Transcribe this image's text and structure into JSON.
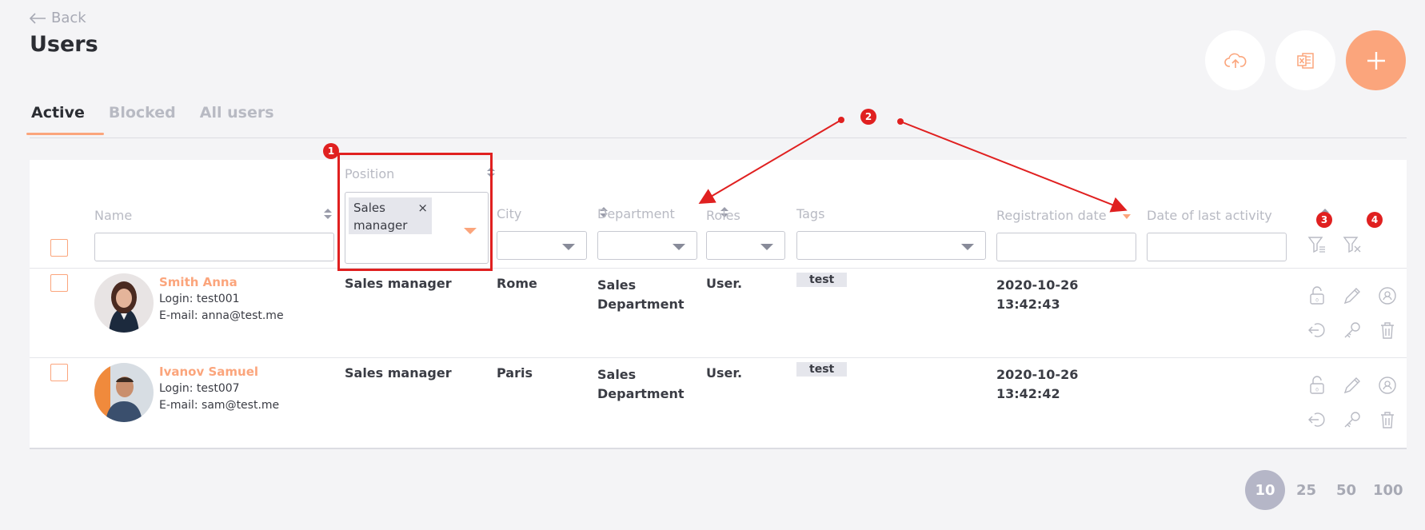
{
  "header": {
    "back_label": "Back",
    "title": "Users"
  },
  "tabs": [
    {
      "label": "Active",
      "active": true
    },
    {
      "label": "Blocked",
      "active": false
    },
    {
      "label": "All users",
      "active": false
    }
  ],
  "columns": {
    "name": "Name",
    "position": "Position",
    "city": "City",
    "department": "Department",
    "roles": "Roles",
    "tags": "Tags",
    "registration_date": "Registration date",
    "last_activity": "Date of last activity"
  },
  "filters": {
    "position_chip_line1": "Sales",
    "position_chip_line2": "manager",
    "position_chip_remove": "×"
  },
  "rows": [
    {
      "name": "Smith Anna",
      "login": "Login: test001",
      "email": "E-mail: anna@test.me",
      "position": "Sales manager",
      "city": "Rome",
      "department_line1": "Sales",
      "department_line2": "Department",
      "roles": "User.",
      "tag": "test",
      "reg_date": "2020-10-26",
      "reg_time": "13:42:43"
    },
    {
      "name": "Ivanov Samuel",
      "login": "Login: test007",
      "email": "E-mail: sam@test.me",
      "position": "Sales manager",
      "city": "Paris",
      "department_line1": "Sales",
      "department_line2": "Department",
      "roles": "User.",
      "tag": "test",
      "reg_date": "2020-10-26",
      "reg_time": "13:42:42"
    }
  ],
  "pagination": [
    "10",
    "25",
    "50",
    "100"
  ],
  "annotations": [
    "1",
    "2",
    "3",
    "4"
  ],
  "colors": {
    "accent": "#fba57c",
    "annotation": "#e02020",
    "muted": "#b8bac3"
  }
}
